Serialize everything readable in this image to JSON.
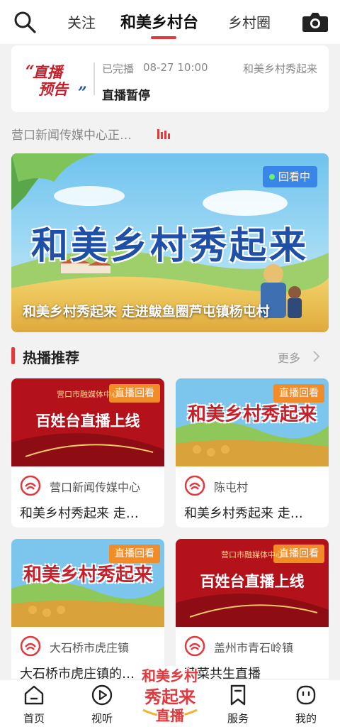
{
  "header": {
    "tabs": [
      {
        "label": "关注"
      },
      {
        "label": "和美乡村台"
      },
      {
        "label": "乡村圈"
      }
    ],
    "active_tab": "和美乡村台",
    "search_icon": "search-icon",
    "camera_icon": "camera-icon"
  },
  "live_preview": {
    "logo_text_line1": "直播",
    "logo_text_line2": "预告",
    "status": "已完播",
    "time": "08-27 10:00",
    "source": "和美乡村秀起来",
    "title": "直播暂停"
  },
  "ticker": {
    "text": "营口新闻传媒中心正…"
  },
  "banner": {
    "badge": "回看中",
    "art_title": "和美乡村秀起来",
    "caption": "和美乡村秀起来 走进鲅鱼圈芦屯镇杨屯村"
  },
  "section": {
    "title": "热播推荐",
    "more": "更多"
  },
  "cards": [
    {
      "badge": "直播回看",
      "thumb_text": "百姓台直播上线",
      "thumb_sub": "营口市融媒体中心",
      "source": "营口新闻传媒中心",
      "title": "和美乡村秀起来 走…"
    },
    {
      "badge": "直播回看",
      "thumb_text": "和美乡村秀起来",
      "thumb_sub": "",
      "source": "陈屯村",
      "title": "和美乡村秀起来 走…"
    },
    {
      "badge": "直播回看",
      "thumb_text": "和美乡村秀起来",
      "thumb_sub": "",
      "source": "大石桥市虎庄镇",
      "title": "大石桥市虎庄镇的…"
    },
    {
      "badge": "直播回看",
      "thumb_text": "百姓台直播上线",
      "thumb_sub": "营口市融媒体中心",
      "source": "盖州市青石岭镇",
      "title": "蔬菜共生直播"
    }
  ],
  "bottom_nav": {
    "items": [
      {
        "label": "首页",
        "icon": "home-icon"
      },
      {
        "label": "视听",
        "icon": "play-icon"
      },
      {
        "label": "服务",
        "icon": "bookmark-icon"
      },
      {
        "label": "我的",
        "icon": "profile-icon"
      }
    ],
    "center_logo_line1": "和美乡村",
    "center_logo_line2": "秀起来",
    "center_logo_line3": "直播"
  },
  "colors": {
    "accent": "#e0393e",
    "badge_blue": "#3a86e8",
    "badge_orange": "#f28c28"
  }
}
